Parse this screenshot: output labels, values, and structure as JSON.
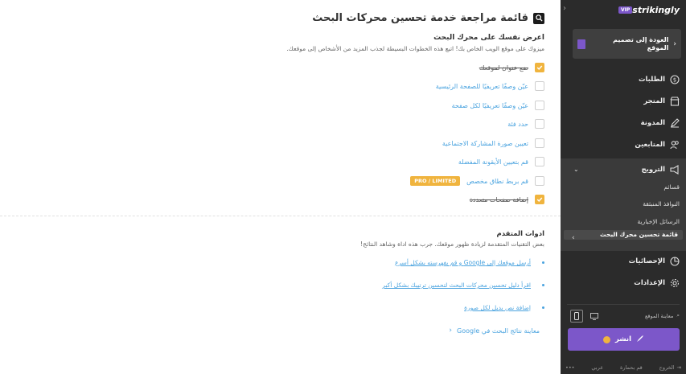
{
  "main": {
    "title": "قائمة مراجعة خدمة تحسين محركات البحث",
    "section_heading": "اعرض نفسك على محرك البحث",
    "section_desc": "ميزوك على موقع الويب الخاص بك! اتبع هذه الخطوات البسيطة لجذب المزيد من الأشخاص إلى موقعك.",
    "checklist": [
      {
        "label": "ضع عنوان لموقعك",
        "checked": true
      },
      {
        "label": "عيّن وصفًا تعريفيًا للصفحة الرئيسية",
        "checked": false
      },
      {
        "label": "عيّن وصفًا تعريفيًا لكل صفحة",
        "checked": false
      },
      {
        "label": "حدد فئة",
        "checked": false
      },
      {
        "label": "تعيين صورة المشاركة الاجتماعية",
        "checked": false
      },
      {
        "label": "قم بتعيين الأيقونة المفضلة",
        "checked": false
      },
      {
        "label": "قم بربط نطاق مخصص",
        "checked": false,
        "badge": "PRO / LIMITED"
      },
      {
        "label": "إضافة صفحات متعددة",
        "checked": true
      }
    ],
    "advanced_heading": "ادوات المتقدم",
    "advanced_desc": "بعض التقنيات المتقدمة لزيادة ظهور موقعك. جرب هذه اداة وشاهد النتائج!",
    "advanced_links": [
      "أرسل موقعك إلى Google و قم بفهرسته بشكل أسرع",
      "اقرأ دليل تحسين محركات البحث لتحسين ترتيبك بشكل أكبر",
      "إضافة نص بديل لكل صورة"
    ],
    "preview_link": "معاينة نتائج البحث في Google"
  },
  "sidebar": {
    "logo": "strikingly",
    "vip": "VIP",
    "back_label": "العودة إلى تصميم الموقع",
    "nav": [
      {
        "label": "الطلبات",
        "icon": "dollar-icon"
      },
      {
        "label": "المتجر",
        "icon": "shop-icon"
      },
      {
        "label": "المدونة",
        "icon": "pen-icon"
      },
      {
        "label": "المتابعين",
        "icon": "people-icon"
      },
      {
        "label": "الترويج",
        "icon": "megaphone-icon"
      }
    ],
    "sub_items": [
      "قسائم",
      "النوافذ المنبثقة",
      "الرسائل الإخبارية",
      "قائمة تحسين محرك البحث"
    ],
    "nav_bottom": [
      {
        "label": "الإحصائيات",
        "icon": "chart-icon"
      },
      {
        "label": "الإعدادات",
        "icon": "gear-icon"
      }
    ],
    "preview_site": "معاينة الموقع",
    "publish": "انشر",
    "footer": {
      "logout": "الخروج",
      "help": "قم بحمارة",
      "lang": "عربي",
      "more": "•••"
    }
  },
  "colors": {
    "accent": "#7c57c9",
    "badge": "#f0b43e",
    "link": "#4aa3df",
    "sidebar_bg": "#2b2b2b"
  }
}
